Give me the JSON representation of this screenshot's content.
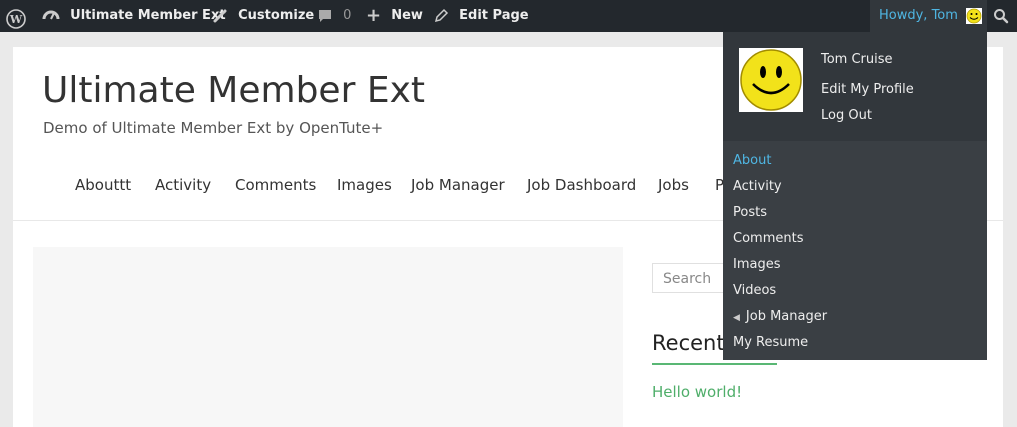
{
  "adminbar": {
    "site_name": "Ultimate Member Ext",
    "customize": "Customize",
    "comments_count": "0",
    "new": "New",
    "edit_page": "Edit Page",
    "howdy": "Howdy, Tom"
  },
  "site": {
    "title": "Ultimate Member Ext",
    "description": "Demo of Ultimate Member Ext by OpenTute+"
  },
  "nav": {
    "items": [
      "Abouttt",
      "Activity",
      "Comments",
      "Images",
      "Job Manager",
      "Job Dashboard",
      "Jobs",
      "P"
    ]
  },
  "sidebar": {
    "search_placeholder": "Search",
    "recent_title": "Recent",
    "recent_post": "Hello world!"
  },
  "user_menu": {
    "name": "Tom Cruise",
    "edit_profile": "Edit My Profile",
    "logout": "Log Out",
    "items": [
      "About",
      "Activity",
      "Posts",
      "Comments",
      "Images",
      "Videos",
      "Job Manager",
      "My Resume"
    ],
    "active_item": "About"
  },
  "colors": {
    "adminbar_bg": "#23282d",
    "accent_blue": "#4fb6e3",
    "accent_green": "#59b774"
  }
}
